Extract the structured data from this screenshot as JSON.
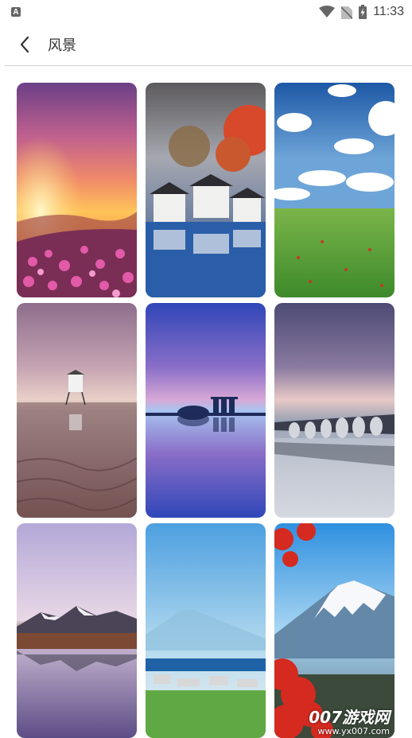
{
  "status_bar": {
    "time": "11:33",
    "notification_icon_letter": "A"
  },
  "toolbar": {
    "title": "风景"
  },
  "wallpapers": [
    {
      "scene": "sunset-flowers"
    },
    {
      "scene": "village-autumn"
    },
    {
      "scene": "sky-field"
    },
    {
      "scene": "lifeguard-tower"
    },
    {
      "scene": "city-reflection"
    },
    {
      "scene": "stone-bridge"
    },
    {
      "scene": "mountain-lake"
    },
    {
      "scene": "misty-mount-fuji"
    },
    {
      "scene": "mount-fuji-red-leaves"
    }
  ],
  "watermark": {
    "brand": "007游戏网",
    "url": "www.yx007.com"
  }
}
